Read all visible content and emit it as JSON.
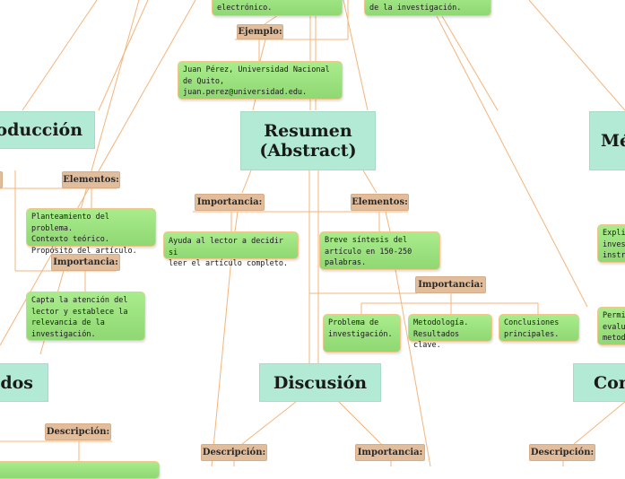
{
  "topics": {
    "introduccion": "Introducción",
    "resumen": "Resumen (Abstract)",
    "metodos": "Métodos",
    "resultados": "Resultados",
    "discusion": "Discusión",
    "conclusiones": "Conclusiones"
  },
  "labels": {
    "ejemplo": "Ejemplo:",
    "resumen_importancia": "Importancia:",
    "resumen_elementos": "Elementos:",
    "elementos_importancia": "Importancia:",
    "intro_elementos": "Elementos:",
    "intro_importancia": "Importancia:",
    "resultados_descripcion": "Descripción:",
    "discusion_descripcion": "Descripción:",
    "discusion_importancia": "Importancia:",
    "conclusiones_descripcion": "Descripción:"
  },
  "notes": {
    "top_left": "electrónico.",
    "top_right": "de la investigación.",
    "ejemplo_autor": " Juan Pérez, Universidad Nacional\nde Quito,\njuan.perez@universidad.edu.",
    "resumen_importancia": "Ayuda al lector a decidir si\nleer el artículo completo.",
    "resumen_elementos": "Breve síntesis del\nartículo en 150-250\npalabras.",
    "problema": "Problema de\ninvestigación.",
    "metodologia": "Metodología.\nResultados clave.",
    "conclusiones_principales": "Conclusiones\nprincipales.",
    "intro_elementos": "Planteamiento del problema.\nContexto teórico.\nPropósito del artículo.",
    "intro_importancia": "Capta la atención del\nlector y establece la\nrelevancia de la\ninvestigación.",
    "metodos_explica": "Explica\ninvest\ninstru",
    "metodos_permite": "Permit\nevalua\nmetodo"
  }
}
